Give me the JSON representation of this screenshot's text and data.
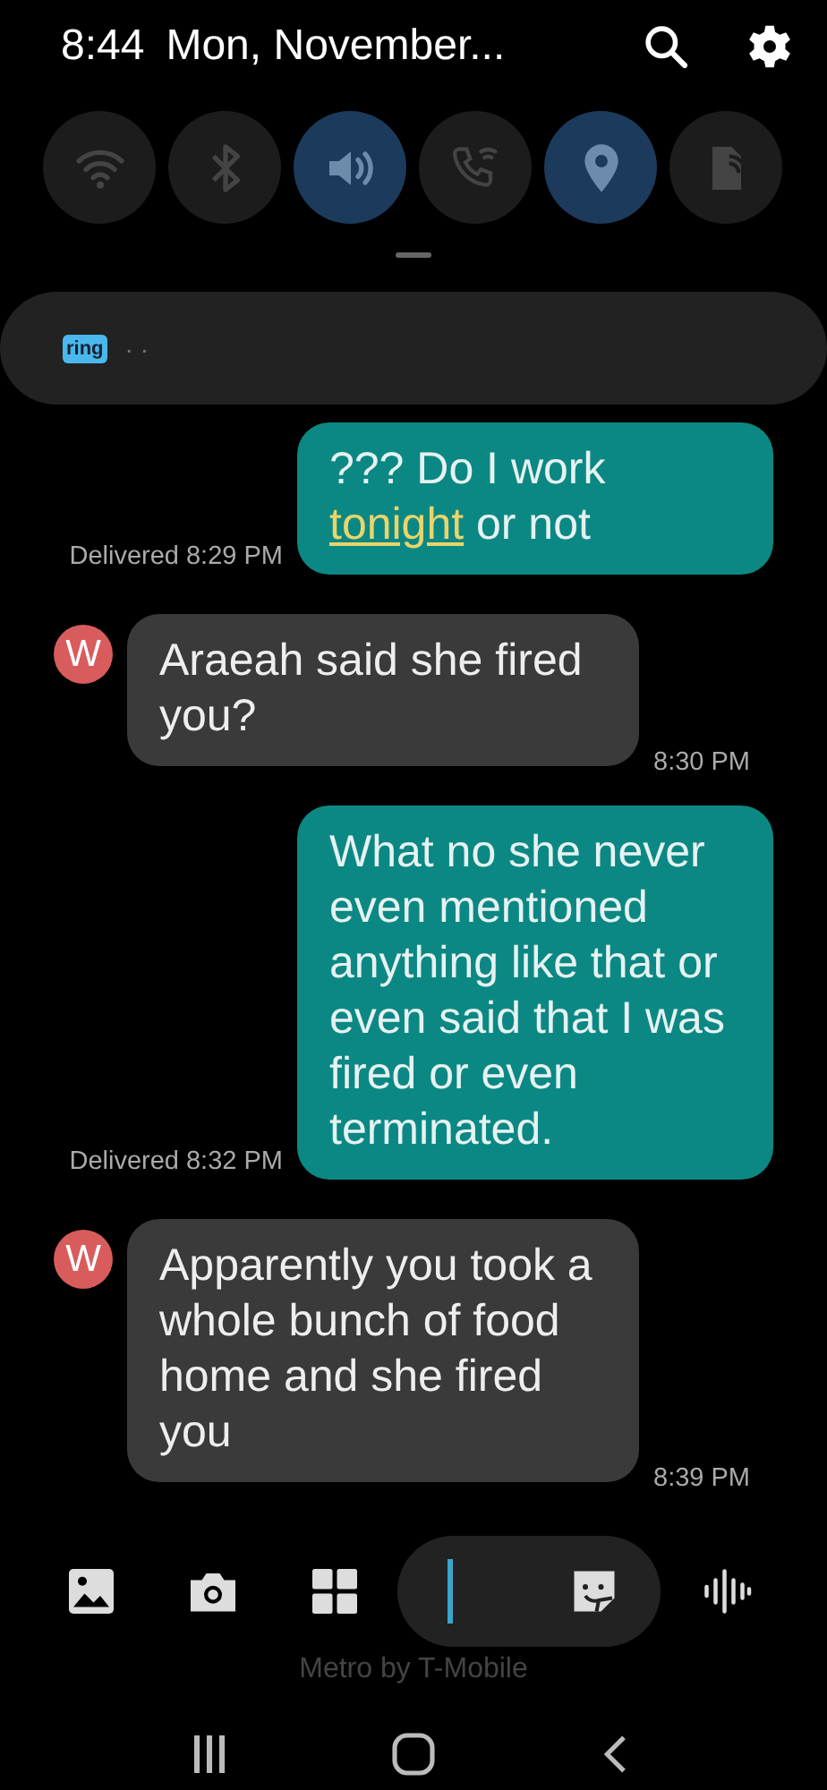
{
  "status_bar": {
    "time": "8:44",
    "date": "Mon, November..."
  },
  "quick_toggles": [
    {
      "kind": "wifi",
      "on": false
    },
    {
      "kind": "bluetooth",
      "on": false
    },
    {
      "kind": "sound",
      "on": true
    },
    {
      "kind": "wifi_calling",
      "on": false
    },
    {
      "kind": "location",
      "on": true
    },
    {
      "kind": "hotspot",
      "on": false
    }
  ],
  "notification": {
    "app_icon_text": "ring",
    "text": "· ·"
  },
  "messages": [
    {
      "kind": "outgoing",
      "segments": [
        {
          "text": "??? Do I work "
        },
        {
          "text": "tonight",
          "kind": "link"
        },
        {
          "text": " or not"
        }
      ],
      "meta": "Delivered 8:29 PM"
    },
    {
      "kind": "incoming",
      "avatar": "W",
      "segments": [
        {
          "text": "Araeah said she fired you?"
        }
      ],
      "meta": "8:30 PM"
    },
    {
      "kind": "outgoing",
      "segments": [
        {
          "text": "What no she never even mentioned anything like that or even said that I was fired or even terminated."
        }
      ],
      "meta": "Delivered 8:32 PM"
    },
    {
      "kind": "incoming",
      "avatar": "W",
      "segments": [
        {
          "text": "Apparently you took a whole bunch of food home and she fired you"
        }
      ],
      "meta": "8:39 PM"
    }
  ],
  "carrier": "Metro by T-Mobile"
}
